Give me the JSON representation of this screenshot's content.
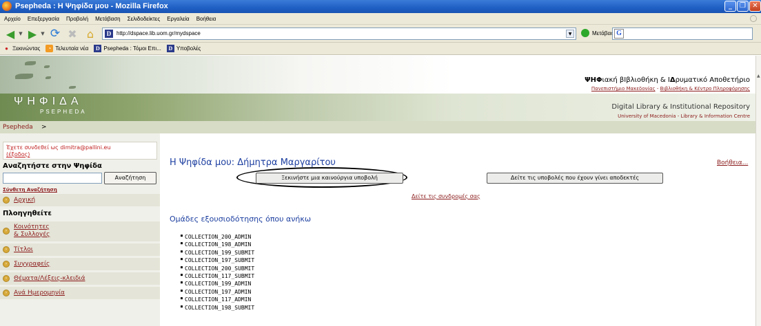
{
  "window": {
    "title": "Psepheda : Η Ψηφίδα μου - Mozilla Firefox"
  },
  "menu": [
    "Αρχείο",
    "Επεξεργασία",
    "Προβολή",
    "Μετάβαση",
    "Σελιδοδείκτες",
    "Εργαλεία",
    "Βοήθεια"
  ],
  "nav": {
    "url": "http://dspace.lib.uom.gr/mydspace",
    "go_label": "Μετάβαση",
    "search_letter": "G"
  },
  "bookmarks": [
    "Ξεκινώντας",
    "Τελευταία νέα",
    "Psepheda : Τόμοι Επι...",
    "Υποβολές"
  ],
  "header": {
    "logo": "ΨΗΦΙΔΑ",
    "logo_sub": "PSEPHEDA",
    "gr_title_bold": "ΨΗΦ",
    "gr_title_rest": "ιακή βΙβλιοθήκη & Ι",
    "gr_title_bold2": "Δ",
    "gr_title_rest2": "ρυματικό Αποθετήριο",
    "gr_link1": "Πανεπιστήμιο Μακεδονίας",
    "gr_link2": "Βιβλιοθήκη & Κέντρο Πληροφόρησης",
    "en_title": "Digital Library & Institutional Repository",
    "en_links": "University of Macedonia - Library & Information Centre"
  },
  "breadcrumb": {
    "root": "Psepheda",
    "sep": ">"
  },
  "sidebar": {
    "logged_in": "Έχετε συνδεθεί ως dimitra@pallini.eu",
    "logout": "(έξοδος)",
    "search_title": "Αναζητήστε στην Ψηφίδα",
    "search_button": "Αναζήτηση",
    "advanced_search": "Σύνθετη Αναζήτηση",
    "home": "Αρχική",
    "browse_title": "Πλοηγηθείτε",
    "browse": [
      {
        "line1": "Κοινότητες",
        "line2": "& Συλλογές"
      },
      {
        "line1": "Τίτλοι"
      },
      {
        "line1": "Συγγραφείς"
      },
      {
        "line1": "Θέματα/Λέξεις-κλειδιά"
      },
      {
        "line1": "Ανά Ημερομηνία"
      }
    ]
  },
  "main": {
    "title": "Η Ψηφίδα μου: Δήμητρα Μαργαρίτου",
    "help": "Βοήθεια...",
    "start_button": "Ξεκινήστε μια καινούργια υποβολή",
    "accepted_button": "Δείτε τις υποβολές που έχουν γίνει αποδεκτές",
    "subscriptions_link": "Δείτε τις συνδρομές σας",
    "groups_title": "Ομάδες εξουσιοδότησης όπου ανήκω",
    "groups": [
      "COLLECTION_200_ADMIN",
      "COLLECTION_198_ADMIN",
      "COLLECTION_199_SUBMIT",
      "COLLECTION_197_SUBMIT",
      "COLLECTION_200_SUBMIT",
      "COLLECTION_117_SUBMIT",
      "COLLECTION_199_ADMIN",
      "COLLECTION_197_ADMIN",
      "COLLECTION_117_ADMIN",
      "COLLECTION_198_SUBMIT"
    ]
  }
}
